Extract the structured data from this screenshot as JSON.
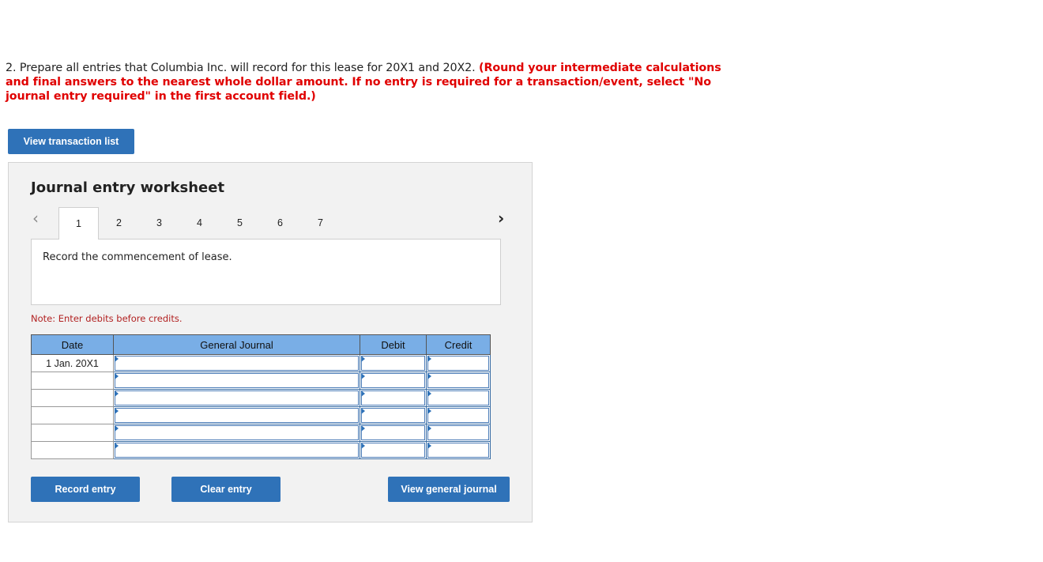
{
  "question": {
    "plain": "2. Prepare all entries that Columbia Inc. will record for this lease for 20X1 and 20X2. ",
    "instructions": "(Round your intermediate calculations and final answers to the nearest whole dollar amount. If no entry is required for a transaction/event, select \"No journal entry required\" in the first account field.)"
  },
  "buttons": {
    "view_transaction_list": "View transaction list",
    "record_entry": "Record entry",
    "clear_entry": "Clear entry",
    "view_general_journal": "View general journal"
  },
  "worksheet": {
    "title": "Journal entry worksheet",
    "prev_icon": "‹",
    "next_icon": "›",
    "tabs": [
      "1",
      "2",
      "3",
      "4",
      "5",
      "6",
      "7"
    ],
    "active_tab": "1",
    "description": "Record the commencement of lease.",
    "note": "Note: Enter debits before credits."
  },
  "journal_table": {
    "headers": {
      "date": "Date",
      "general_journal": "General Journal",
      "debit": "Debit",
      "credit": "Credit"
    },
    "rows": [
      {
        "date": "1 Jan. 20X1",
        "account": "",
        "debit": "",
        "credit": ""
      },
      {
        "date": "",
        "account": "",
        "debit": "",
        "credit": ""
      },
      {
        "date": "",
        "account": "",
        "debit": "",
        "credit": ""
      },
      {
        "date": "",
        "account": "",
        "debit": "",
        "credit": ""
      },
      {
        "date": "",
        "account": "",
        "debit": "",
        "credit": ""
      },
      {
        "date": "",
        "account": "",
        "debit": "",
        "credit": ""
      }
    ]
  },
  "colors": {
    "accent": "#2f72b8",
    "header_blue": "#79aee6",
    "instruction_red": "#e00000",
    "panel_bg": "#f2f2f2"
  }
}
